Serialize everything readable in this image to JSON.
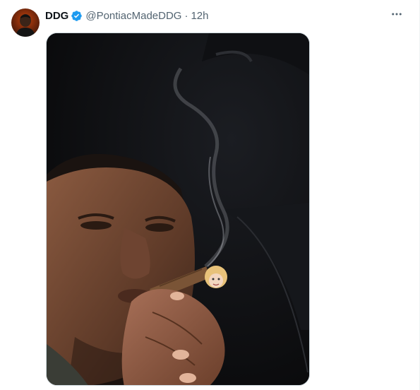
{
  "tweet": {
    "author_name": "DDG",
    "handle": "@PontiacMadeDDG",
    "separator": "·",
    "timestamp": "12h",
    "verified": true,
    "more_icon": "more-horizontal-icon",
    "verified_icon": "verified-badge-icon"
  },
  "colors": {
    "text_primary": "#0f1419",
    "text_secondary": "#536471",
    "verified_blue": "#1d9bf0",
    "border": "#cfd9de"
  }
}
